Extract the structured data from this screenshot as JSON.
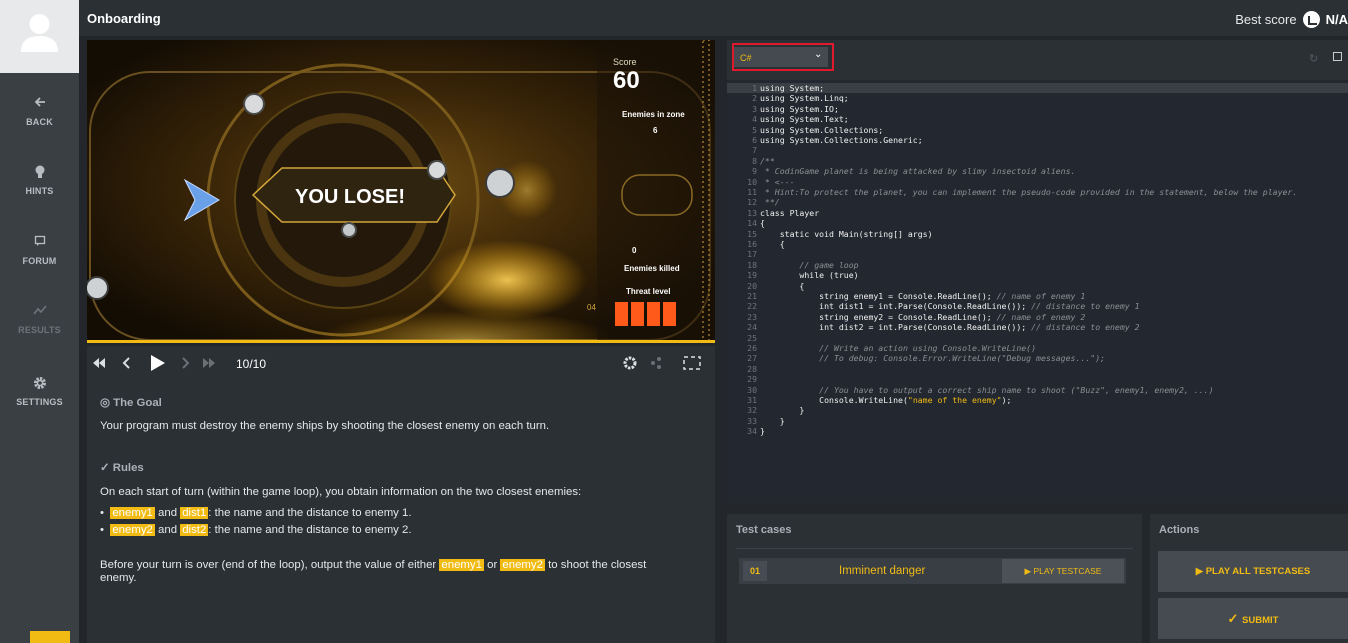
{
  "header": {
    "title": "Onboarding",
    "best_score_label": "Best score",
    "best_score_value": "N/A"
  },
  "sidebar": {
    "items": [
      {
        "label": "BACK",
        "icon": "arrow-left-icon"
      },
      {
        "label": "HINTS",
        "icon": "lightbulb-icon"
      },
      {
        "label": "FORUM",
        "icon": "chat-icon"
      },
      {
        "label": "RESULTS",
        "icon": "chart-icon"
      },
      {
        "label": "SETTINGS",
        "icon": "gear-icon"
      }
    ]
  },
  "game": {
    "score_label": "Score",
    "score_value": "60",
    "enemies_zone_label": "Enemies in zone",
    "enemies_zone_value": "6",
    "enemies_killed_label": "Enemies killed",
    "enemies_killed_value": "0",
    "threat_label": "Threat level",
    "threat_value": "04",
    "banner": "YOU LOSE!"
  },
  "player": {
    "frame": "10/10"
  },
  "statement": {
    "goal_title": "The Goal",
    "goal_text": "Your program must destroy the enemy ships by shooting the closest enemy on each turn.",
    "rules_title": "Rules",
    "rules_text": "On each start of turn (within the game loop), you obtain information on the two closest enemies:",
    "b1_v1": "enemy1",
    "b1_and": "and",
    "b1_v2": "dist1",
    "b1_rest": ": the name and the distance to enemy 1.",
    "b2_v1": "enemy2",
    "b2_and": "and",
    "b2_v2": "dist2",
    "b2_rest": ": the name and the distance to enemy 2.",
    "end_text1": "Before your turn is over (end of the loop), output the value of either",
    "end_v1": "enemy1",
    "end_or": "or",
    "end_v2": "enemy2",
    "end_text2": "to shoot the closest",
    "end_text3": "enemy."
  },
  "editor": {
    "language": "C#"
  },
  "code_lines": [
    "using System;",
    "using System.Linq;",
    "using System.IO;",
    "using System.Text;",
    "using System.Collections;",
    "using System.Collections.Generic;",
    "",
    "/**",
    " * CodinGame planet is being attacked by slimy insectoid aliens.",
    " * <---",
    " * Hint:To protect the planet, you can implement the pseudo-code provided in the statement, below the player.",
    " **/",
    "class Player",
    "{",
    "    static void Main(string[] args)",
    "    {",
    "",
    "        // game loop",
    "        while (true)",
    "        {",
    "            string enemy1 = Console.ReadLine(); // name of enemy 1",
    "            int dist1 = int.Parse(Console.ReadLine()); // distance to enemy 1",
    "            string enemy2 = Console.ReadLine(); // name of enemy 2",
    "            int dist2 = int.Parse(Console.ReadLine()); // distance to enemy 2",
    "",
    "            // Write an action using Console.WriteLine()",
    "            // To debug: Console.Error.WriteLine(\"Debug messages...\");",
    "",
    "",
    "            // You have to output a correct ship name to shoot (\"Buzz\", enemy1, enemy2, ...)",
    "            Console.WriteLine(\"name of the enemy\");",
    "        }",
    "    }",
    "}"
  ],
  "tests": {
    "title": "Test cases",
    "items": [
      {
        "num": "01",
        "name": "Imminent danger",
        "button": "PLAY TESTCASE"
      }
    ]
  },
  "actions": {
    "title": "Actions",
    "play_all": "PLAY ALL TESTCASES",
    "submit": "SUBMIT"
  }
}
